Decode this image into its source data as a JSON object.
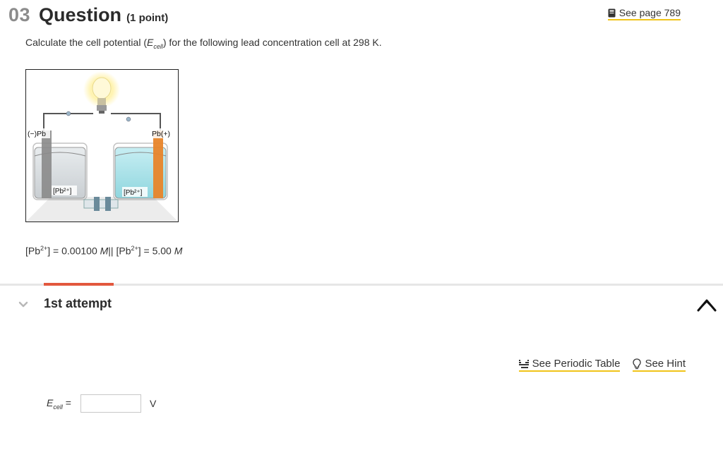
{
  "question": {
    "number": "03",
    "title": "Question",
    "points": "(1 point)",
    "see_page": "See page 789"
  },
  "prompt": {
    "pre": "Calculate the cell potential (",
    "symbol": "E",
    "symbol_sub": "cell",
    "post": ") for the following lead concentration cell at 298 K."
  },
  "figure": {
    "left_electrode": "(−)Pb",
    "right_electrode": "Pb(+)",
    "left_solution": "[Pb²⁺]",
    "right_solution": "[Pb²⁺]",
    "icons": [
      "light-bulb-icon",
      "beaker-icon",
      "salt-bridge-icon"
    ]
  },
  "concentrations": {
    "left_prefix": "[Pb",
    "left_charge": "2+",
    "left_value": "] = 0.00100 ",
    "left_unit": "M",
    "separator": "||",
    "right_prefix": " [Pb",
    "right_charge": "2+",
    "right_value": "] = 5.00 ",
    "right_unit": "M"
  },
  "attempt": {
    "label": "1st attempt"
  },
  "tools": {
    "periodic_table": "See Periodic Table",
    "hint": "See Hint"
  },
  "answer": {
    "symbol": "E",
    "symbol_sub": "cell",
    "equals": " =",
    "value": "",
    "unit": "V"
  },
  "colors": {
    "accent": "#e2583e",
    "link_underline": "#f0c419",
    "muted_number": "#8c8c8c"
  }
}
